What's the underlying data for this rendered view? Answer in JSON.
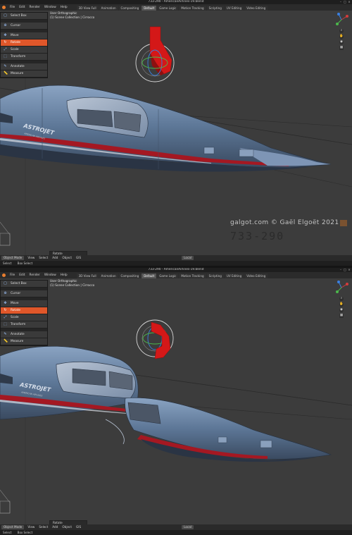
{
  "window": {
    "title_top": "733-290 - AmericanAirlines-19.blend",
    "title_bottom": "733-290 - AmericanAirlines-19.blend",
    "controls": [
      "–",
      "□",
      "×"
    ]
  },
  "menus": [
    "File",
    "Edit",
    "Render",
    "Window",
    "Help"
  ],
  "workspace_tabs": [
    "3D View Full",
    "Animation",
    "Compositing",
    "Default",
    "Game Logic",
    "Motion Tracking",
    "Scripting",
    "UV Editing",
    "Video Editing"
  ],
  "active_tab": "Default",
  "viewport": {
    "view_name": "User Orthographic",
    "collection_path": "(1) Scene Collection | Cirrocco"
  },
  "tools": [
    "Select Box",
    "Cursor",
    "Move",
    "Rotate",
    "Scale",
    "Transform",
    "Annotate",
    "Measure"
  ],
  "active_tool": "Rotate",
  "operator_panel": "Rotate",
  "header": {
    "mode": "Object Mode",
    "menus": [
      "View",
      "Select",
      "Add",
      "Object",
      "GIS"
    ],
    "orientation": "Local"
  },
  "statusbar": [
    "Select",
    "Box Select"
  ],
  "artwork": {
    "watermark": "galgot.com © Gaël Elgoët 2021",
    "tail_number": "733-290",
    "livery_name": "ASTROJET",
    "livery_tagline": "AMERICAN AIRLINES"
  },
  "colors": {
    "accent": "#e0572a",
    "gizmo_red": "#d41818",
    "stripe_red": "#a41822",
    "fuselage": "#6a85a8"
  },
  "icons": [
    "search-icon",
    "hand-icon",
    "camera-icon",
    "grid-icon",
    "cursor-icon",
    "move-icon",
    "rotate-icon",
    "scale-icon",
    "transform-icon",
    "annotate-icon",
    "measure-icon"
  ]
}
